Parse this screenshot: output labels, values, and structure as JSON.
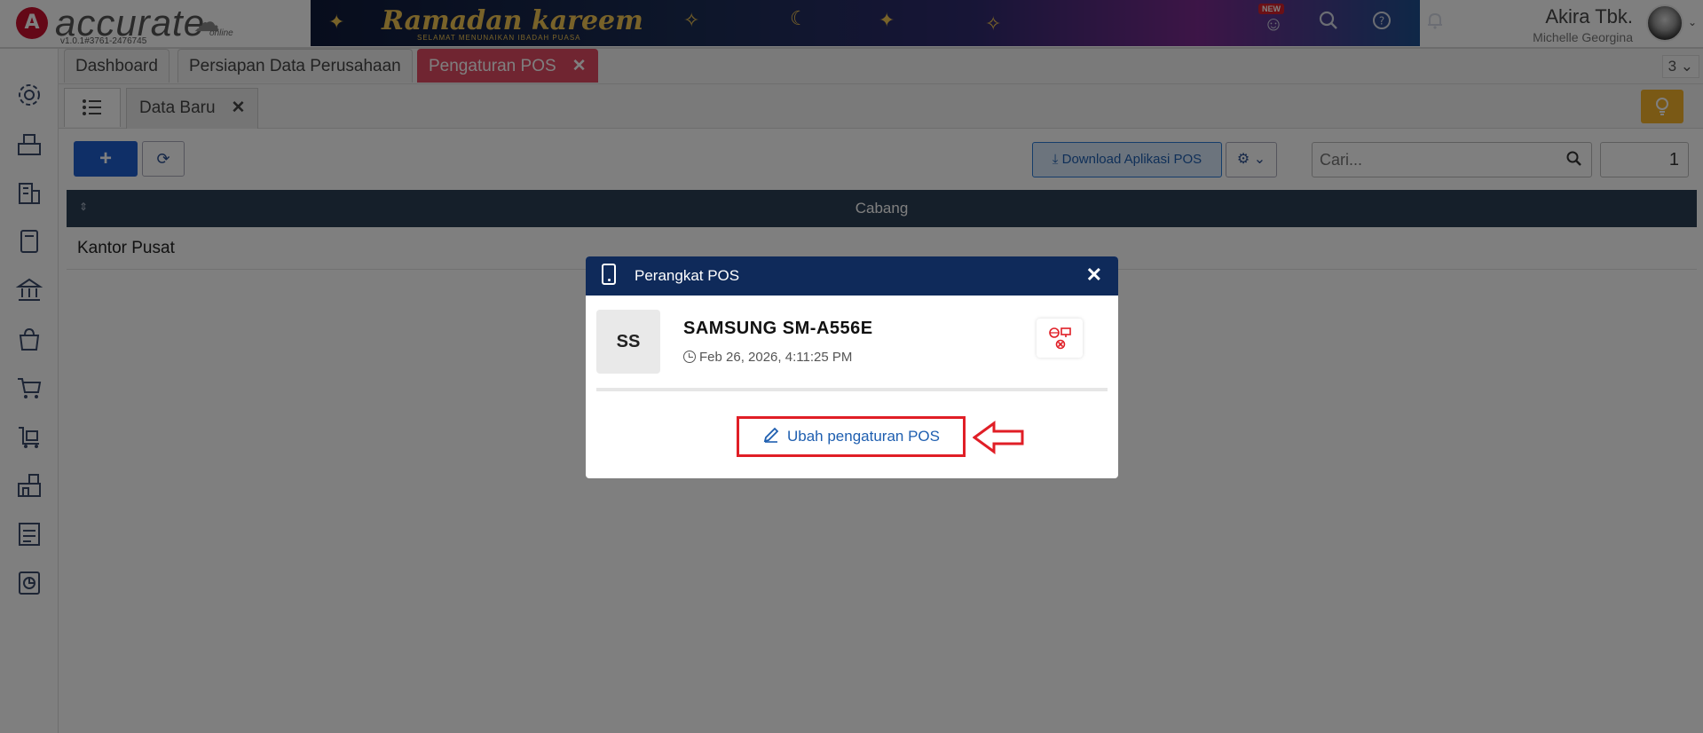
{
  "header": {
    "logo_text": "accurate",
    "logo_sub": "online",
    "version": "v1.0.1#3761-2476745",
    "banner_title": "Ramadan kareem",
    "banner_sub": "SELAMAT MENUNAIKAN IBADAH PUASA",
    "new_badge": "NEW",
    "user_name": "Akira Tbk.",
    "user_sub": "Michelle Georgina"
  },
  "sidebar": {
    "icons": [
      "settings-icon",
      "pos-register-icon",
      "building-icon",
      "ledger-book-icon",
      "bank-icon",
      "sales-bag-icon",
      "shopping-cart-icon",
      "delivery-cart-icon",
      "warehouse-icon",
      "tax-report-icon",
      "analytics-icon"
    ]
  },
  "tabs": [
    {
      "label": "Dashboard",
      "active": false
    },
    {
      "label": "Persiapan Data Perusahaan",
      "active": false
    },
    {
      "label": "Pengaturan POS",
      "active": true
    }
  ],
  "tab_count": "3",
  "subtab": {
    "label": "Data Baru"
  },
  "toolbar": {
    "add_label": "+",
    "download_label": "Download Aplikasi POS",
    "search_placeholder": "Cari...",
    "page_value": "1"
  },
  "table": {
    "column": "Cabang",
    "rows": [
      {
        "cabang": "Kantor Pusat"
      }
    ]
  },
  "modal": {
    "title": "Perangkat POS",
    "device_initials": "SS",
    "device_name": "SAMSUNG SM-A556E",
    "device_time": "Feb 26, 2026, 4:11:25 PM",
    "edit_label": "Ubah pengaturan POS"
  },
  "colors": {
    "brand_red": "#c8102e",
    "active_tab": "#e04a62",
    "modal_header": "#0f2a5a",
    "primary_blue": "#1f5fcf",
    "highlight_red": "#e01e26"
  }
}
